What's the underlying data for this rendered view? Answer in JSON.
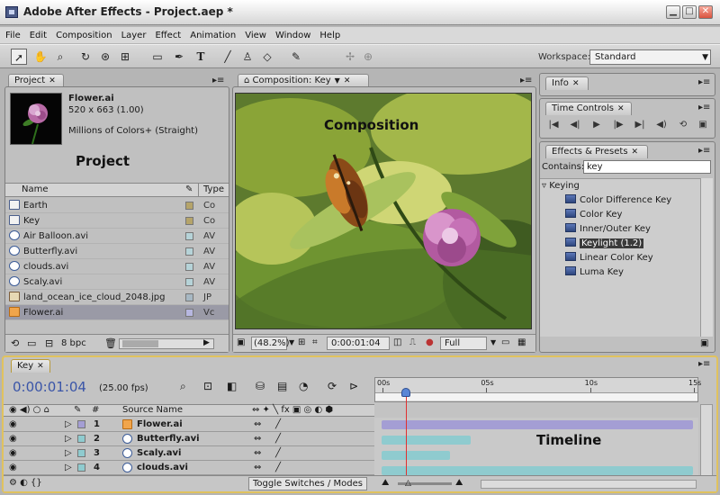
{
  "window": {
    "title": "Adobe After Effects - Project.aep *",
    "controls": [
      "minimize",
      "maximize",
      "close"
    ]
  },
  "menu": [
    "File",
    "Edit",
    "Composition",
    "Layer",
    "Effect",
    "Animation",
    "View",
    "Window",
    "Help"
  ],
  "toolbar": {
    "tools": [
      "selection-tool",
      "hand-tool",
      "zoom-tool",
      "rotation-tool",
      "orbit-camera-tool",
      "pan-behind-tool",
      "rectangle-mask-tool",
      "pen-tool",
      "type-tool",
      "brush-tool",
      "clone-stamp-tool",
      "eraser-tool",
      "puppet-pin-tool"
    ],
    "workspace_label": "Workspace:",
    "workspace_value": "Standard"
  },
  "project": {
    "tab_label": "Project",
    "item_name": "Flower.ai",
    "item_dimensions": "520 x 663 (1.00)",
    "item_colors": "Millions of Colors+ (Straight)",
    "overlay_label": "Project",
    "columns": {
      "name": "Name",
      "type": "Type"
    },
    "files": [
      {
        "name": "Earth",
        "icon": "composition-icon",
        "type": "Co",
        "label_color": "#b5a46a"
      },
      {
        "name": "Key",
        "icon": "composition-icon",
        "type": "Co",
        "label_color": "#b5a46a"
      },
      {
        "name": "Air Balloon.avi",
        "icon": "footage-icon",
        "type": "AV",
        "label_color": "#b6d3d8"
      },
      {
        "name": "Butterfly.avi",
        "icon": "footage-icon",
        "type": "AV",
        "label_color": "#b6d3d8"
      },
      {
        "name": "clouds.avi",
        "icon": "footage-icon",
        "type": "AV",
        "label_color": "#b6d3d8"
      },
      {
        "name": "Scaly.avi",
        "icon": "footage-icon",
        "type": "AV",
        "label_color": "#b6d3d8"
      },
      {
        "name": "land_ocean_ice_cloud_2048.jpg",
        "icon": "image-icon",
        "type": "JP",
        "label_color": "#a7b8c3"
      },
      {
        "name": "Flower.ai",
        "icon": "illustrator-icon",
        "type": "Vc",
        "label_color": "#b7b7e0",
        "selected": true
      }
    ],
    "bit_depth": "8 bpc"
  },
  "composition": {
    "tab_label": "Composition: Key",
    "overlay_label": "Composition",
    "zoom": "(48.2%)",
    "timecode": "0:00:01:04",
    "resolution": "Full"
  },
  "info": {
    "tab_label": "Info"
  },
  "time_controls": {
    "tab_label": "Time Controls"
  },
  "effects": {
    "tab_label": "Effects & Presets",
    "search_label": "Contains:",
    "search_value": "key",
    "category": "Keying",
    "items": [
      "Color Difference Key",
      "Color Key",
      "Inner/Outer Key",
      "Keylight (1.2)",
      "Linear Color Key",
      "Luma Key"
    ],
    "highlighted_index": 3
  },
  "timeline": {
    "tab_label": "Key",
    "timecode": "0:00:01:04",
    "fps": "(25.00 fps)",
    "columns": {
      "number": "#",
      "source": "Source Name"
    },
    "ruler_ticks": [
      "00s",
      "05s",
      "10s",
      "15s"
    ],
    "duration_seconds": 15,
    "playhead_seconds": 1.16,
    "layers": [
      {
        "num": "1",
        "name": "Flower.ai",
        "icon": "illustrator-icon",
        "start": 0,
        "end": 15,
        "color": "#a49ed4"
      },
      {
        "num": "2",
        "name": "Butterfly.avi",
        "icon": "footage-icon",
        "start": 0,
        "end": 4.3,
        "color": "#8fcbcf"
      },
      {
        "num": "3",
        "name": "Scaly.avi",
        "icon": "footage-icon",
        "start": 0,
        "end": 3.3,
        "color": "#8fcbcf"
      },
      {
        "num": "4",
        "name": "clouds.avi",
        "icon": "footage-icon",
        "start": 0,
        "end": 15,
        "color": "#8fcbcf"
      }
    ],
    "overlay_label": "Timeline",
    "toggle_label": "Toggle Switches / Modes"
  }
}
